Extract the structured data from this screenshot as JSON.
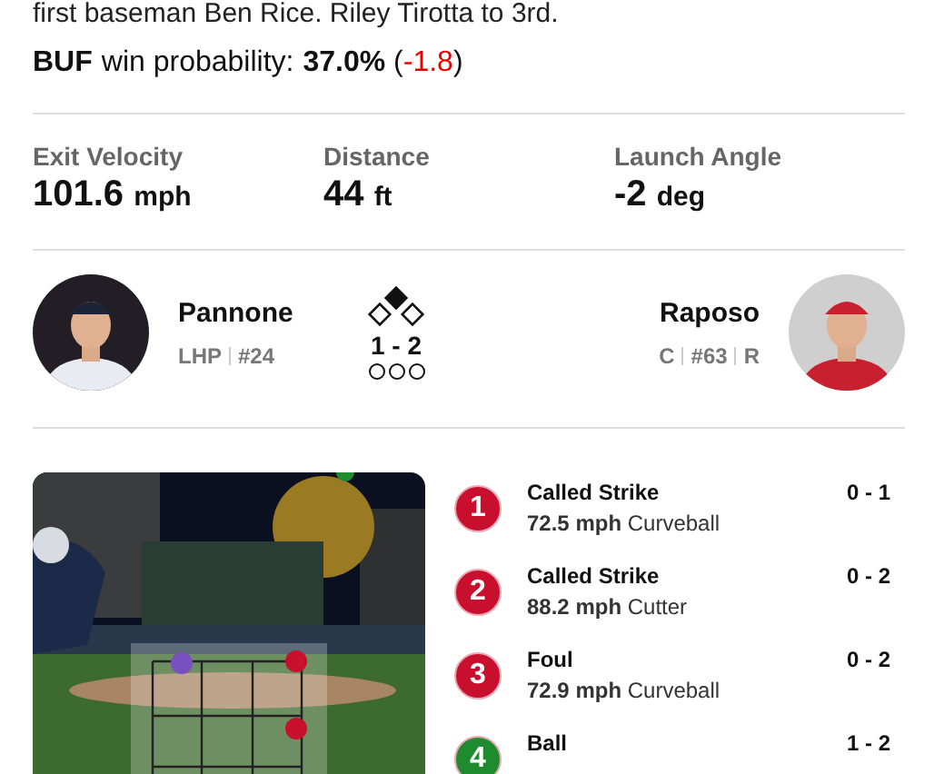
{
  "play_text": "first baseman Ben Rice. Riley Tirotta to 3rd.",
  "win_probability": {
    "team": "BUF",
    "label": "win probability:",
    "value": "37.0%",
    "paren_open": "(",
    "change": "-1.8",
    "paren_close": ")"
  },
  "stats": [
    {
      "label": "Exit Velocity",
      "value": "101.6",
      "unit": "mph"
    },
    {
      "label": "Distance",
      "value": "44",
      "unit": "ft"
    },
    {
      "label": "Launch Angle",
      "value": "-2",
      "unit": "deg"
    }
  ],
  "pitcher": {
    "name": "Pannone",
    "details": [
      "LHP",
      "#24"
    ]
  },
  "batter": {
    "name": "Raposo",
    "details": [
      "C",
      "#63",
      "R"
    ]
  },
  "situation": {
    "bases": {
      "first": false,
      "second": true,
      "third": false
    },
    "count": "1 - 2",
    "outs": [
      false,
      false,
      false
    ]
  },
  "pitches": [
    {
      "number": "1",
      "result": "Called Strike",
      "speed": "72.5 mph",
      "type": "Curveball",
      "count": "0 - 1",
      "color": "#c8102e"
    },
    {
      "number": "2",
      "result": "Called Strike",
      "speed": "88.2 mph",
      "type": "Cutter",
      "count": "0 - 2",
      "color": "#c8102e"
    },
    {
      "number": "3",
      "result": "Foul",
      "speed": "72.9 mph",
      "type": "Curveball",
      "count": "0 - 2",
      "color": "#c8102e"
    },
    {
      "number": "4",
      "result": "Ball",
      "count": "1 - 2",
      "color": "#1e8c2e"
    }
  ]
}
